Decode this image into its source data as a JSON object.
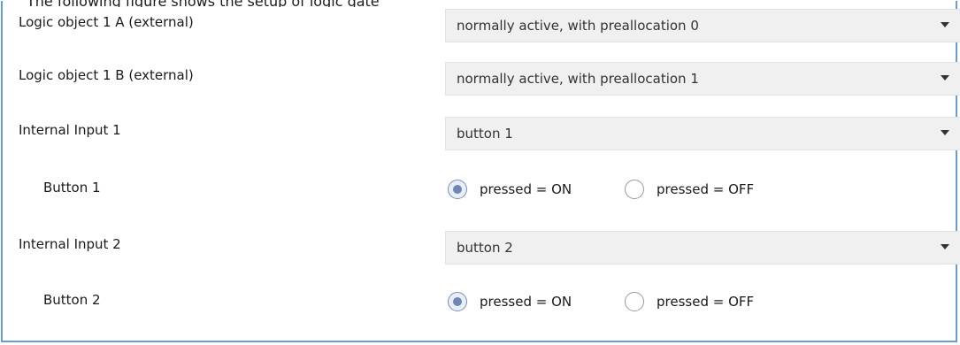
{
  "header_fragment": "The following figure shows the setup of logic gate",
  "rows": [
    {
      "label": "Logic object 1 A (external)",
      "value": "normally active, with preallocation 0"
    },
    {
      "label": "Logic object 1 B (external)",
      "value": "normally active, with preallocation 1"
    },
    {
      "label": "Internal Input 1",
      "value": "button 1"
    },
    {
      "label": "Button 1",
      "options": [
        "pressed = ON",
        "pressed = OFF"
      ],
      "selected": "pressed = ON"
    },
    {
      "label": "Internal Input 2",
      "value": "button 2"
    },
    {
      "label": "Button 2",
      "options": [
        "pressed = ON",
        "pressed = OFF"
      ],
      "selected": "pressed = ON"
    }
  ],
  "colors": {
    "frame_border": "#6b9bd1",
    "select_bg": "#f0f0f0",
    "radio_dot": "#6f86ad"
  },
  "icons": {
    "dropdown": "chevron-down-icon",
    "radio": "radio-button-icon"
  }
}
